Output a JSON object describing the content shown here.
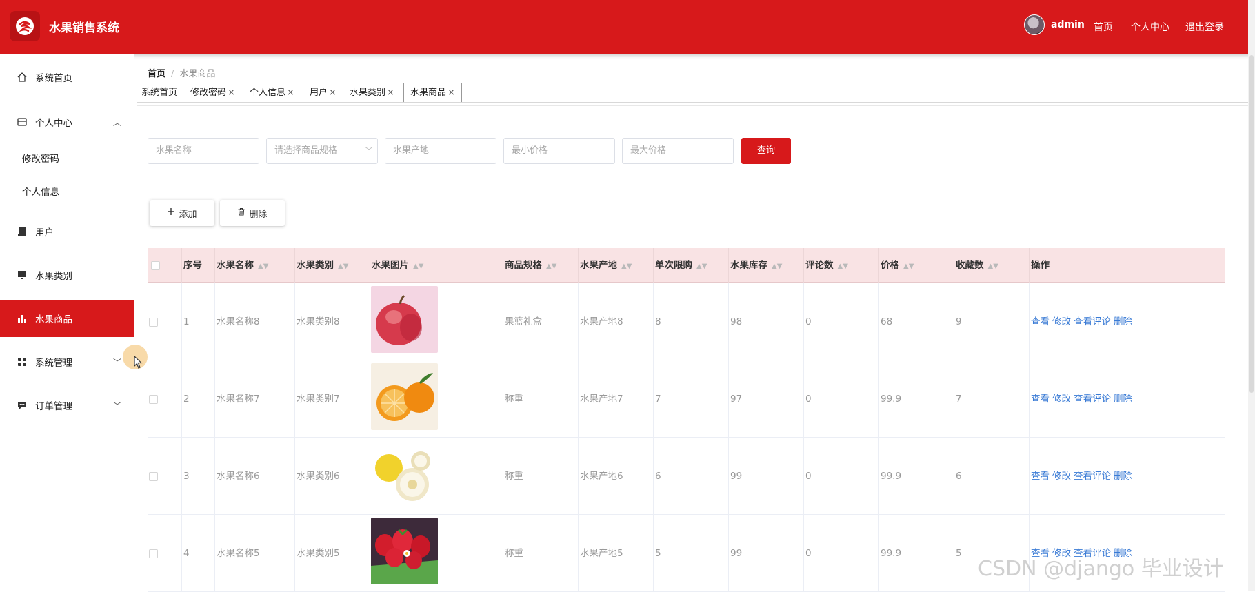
{
  "app": {
    "title": "水果销售系统",
    "user": "admin",
    "links": [
      "首页",
      "个人中心",
      "退出登录"
    ]
  },
  "sidebar": {
    "items": [
      {
        "label": "系统首页",
        "icon": "home-icon"
      },
      {
        "label": "个人中心",
        "icon": "card-icon",
        "expanded": true
      },
      {
        "label": "用户",
        "icon": "monitor-icon"
      },
      {
        "label": "水果类别",
        "icon": "monitor-icon"
      },
      {
        "label": "水果商品",
        "icon": "bar-chart-icon",
        "active": true
      },
      {
        "label": "系统管理",
        "icon": "grid-icon"
      },
      {
        "label": "订单管理",
        "icon": "chat-icon"
      }
    ],
    "sub_items": [
      "修改密码",
      "个人信息"
    ]
  },
  "breadcrumb": {
    "home": "首页",
    "sep": "/",
    "current": "水果商品"
  },
  "tabs": [
    "系统首页",
    "修改密码",
    "个人信息",
    "用户",
    "水果类别",
    "水果商品"
  ],
  "tab_close": "×",
  "search": {
    "name_placeholder": "水果名称",
    "spec_placeholder": "请选择商品规格",
    "origin_placeholder": "水果产地",
    "min_price_placeholder": "最小价格",
    "max_price_placeholder": "最大价格",
    "query_label": "查询"
  },
  "toolbar": {
    "add_label": "添加",
    "delete_label": "删除"
  },
  "table": {
    "headers": [
      "序号",
      "水果名称",
      "水果类别",
      "水果图片",
      "商品规格",
      "水果产地",
      "单次限购",
      "水果库存",
      "评论数",
      "价格",
      "收藏数",
      "操作"
    ],
    "rows": [
      {
        "no": "1",
        "name": "水果名称8",
        "category": "水果类别8",
        "image": "apple",
        "spec": "果篮礼盒",
        "origin": "水果产地8",
        "limit": "8",
        "stock": "98",
        "comments": "0",
        "price": "68",
        "favorites": "9"
      },
      {
        "no": "2",
        "name": "水果名称7",
        "category": "水果类别7",
        "image": "orange",
        "spec": "称重",
        "origin": "水果产地7",
        "limit": "7",
        "stock": "97",
        "comments": "0",
        "price": "99.9",
        "favorites": "7"
      },
      {
        "no": "3",
        "name": "水果名称6",
        "category": "水果类别6",
        "image": "melon",
        "spec": "称重",
        "origin": "水果产地6",
        "limit": "6",
        "stock": "99",
        "comments": "0",
        "price": "99.9",
        "favorites": "6"
      },
      {
        "no": "4",
        "name": "水果名称5",
        "category": "水果类别5",
        "image": "strawberry",
        "spec": "称重",
        "origin": "水果产地5",
        "limit": "5",
        "stock": "99",
        "comments": "0",
        "price": "99.9",
        "favorites": "5"
      }
    ],
    "actions": [
      "查看",
      "修改",
      "查看评论",
      "删除"
    ]
  },
  "watermark": "CSDN @django 毕业设计",
  "colors": {
    "primary": "#d7191b",
    "header_row": "#f9e3e4",
    "link": "#3a7bd5"
  }
}
